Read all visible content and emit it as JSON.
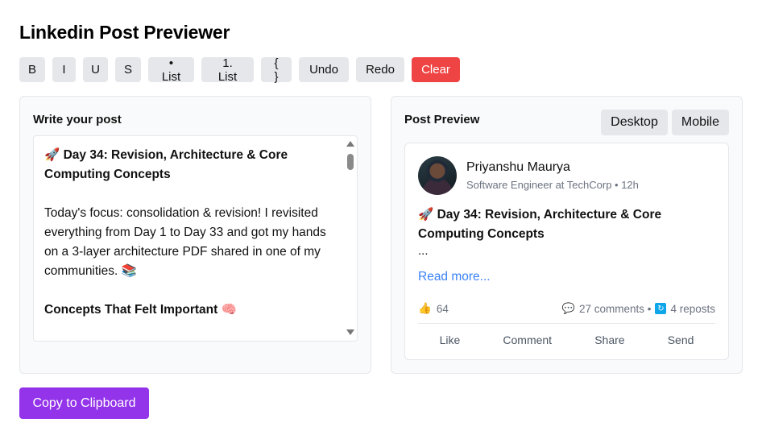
{
  "app": {
    "title": "Linkedin Post Previewer"
  },
  "toolbar": {
    "bold": "B",
    "italic": "I",
    "underline": "U",
    "strike": "S",
    "bullet_list": "• List",
    "numbered_list": "1. List",
    "code": "{ }",
    "undo": "Undo",
    "redo": "Redo",
    "clear": "Clear"
  },
  "editor": {
    "title": "Write your post",
    "heading": "🚀 Day 34: Revision, Architecture & Core Computing Concepts",
    "paragraph": "Today's focus: consolidation & revision! I revisited everything from Day 1 to Day 33 and got my hands on a 3-layer architecture PDF shared in one of my communities. 📚",
    "subheading": " Concepts That Felt Important 🧠"
  },
  "preview": {
    "title": "Post Preview",
    "desktop_label": "Desktop",
    "mobile_label": "Mobile",
    "author_name": "Priyanshu Maurya",
    "author_sub": "Software Engineer at TechCorp • 12h",
    "post_title": "🚀 Day 34: Revision, Architecture & Core Computing Concepts",
    "ellipsis": "...",
    "read_more": "Read more...",
    "likes_icon": "👍",
    "likes": "64",
    "comments": "27 comments •",
    "reposts": "4 reposts",
    "actions": {
      "like": "Like",
      "comment": "Comment",
      "share": "Share",
      "send": "Send"
    }
  },
  "footer": {
    "copy_label": "Copy to Clipboard"
  },
  "colors": {
    "clear": "#ef4444",
    "copy": "#9333ea",
    "link": "#3b82f6"
  }
}
